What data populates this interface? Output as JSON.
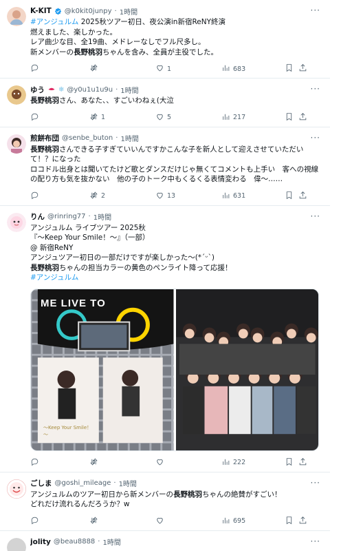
{
  "tweets": [
    {
      "name": "K-KIT",
      "handle": "@k0kit0junpy",
      "time": "1時間",
      "text_html": "<span class=\"tag\">#アンジュルム</span> 2025秋ツアー初日、夜公演in新宿ReNY終演\n燃えました、楽しかった。\nレア曲少な目、全19曲、メドレーなしでフル尺多し。\n新メンバーの<span class=\"hl\">長野桃羽</span>ちゃんを含み、全員が主役でした。",
      "reply": "",
      "retweet": "",
      "like": "1",
      "views": "683"
    },
    {
      "name": "ゆう",
      "handle": "@y0u1u1u9u",
      "time": "1時間",
      "text_html": "<span class=\"hl\">長野桃羽</span>さん、あなた、、すごいわねぇ(大泣",
      "reply": "",
      "retweet": "1",
      "like": "5",
      "views": "217"
    },
    {
      "name": "煎餅布団",
      "handle": "@senbe_buton",
      "time": "1時間",
      "text_html": "<span class=\"hl\">長野桃羽</span>さんできる子すぎていいんですかこんな子を新人として迎えさせていただいて！？になった\nロコドル出身とは聞いてたけど歌とダンスだけじゃ無くてコメントも上手い　客への視線の配り方も気を抜かない　他の子のトーク中もくるくる表情変わる　偉〜……",
      "reply": "",
      "retweet": "2",
      "like": "13",
      "views": "631"
    },
    {
      "name": "りん",
      "handle": "@rinring77",
      "time": "1時間",
      "text_html": "アンジュルム ライブツアー 2025秋\n『〜Keep Your Smile！〜』（一部）\n@ 新宿ReNY\nアンジュツアー初日の一部だけですが楽しかった〜(*ˊᵕˋ)\n<span class=\"hl\">長野桃羽</span>ちゃんの担当カラーの黄色のペンライト降って応援！\n<span class=\"tag\">#アンジュルム</span>",
      "reply": "",
      "retweet": "",
      "like": "",
      "views": "222",
      "towel_text": "ME LIVE TO",
      "poster_text": "～Keep Your Smile！～"
    },
    {
      "name": "ごしま",
      "handle": "@goshi_mileage",
      "time": "1時間",
      "text_html": "アンジュルムのツアー初日から新メンバーの<span class=\"hl\">長野桃羽</span>ちゃんの絶賛がすごい！\nどれだけ流れるんだろうか？w",
      "reply": "",
      "retweet": "",
      "like": "",
      "views": "695"
    },
    {
      "name": "jolity",
      "handle": "@beau8888",
      "time": "1時間"
    }
  ],
  "icons": {
    "more": "more-dots-icon",
    "reply": "reply-bubble-icon",
    "retweet": "retweet-arrows-icon",
    "like": "heart-icon",
    "views": "bar-chart-icon",
    "bookmark": "bookmark-icon",
    "share": "share-upload-icon"
  },
  "colors": {
    "accent": "#1d9bf0",
    "muted": "#536471",
    "border": "#e6ecf0"
  }
}
